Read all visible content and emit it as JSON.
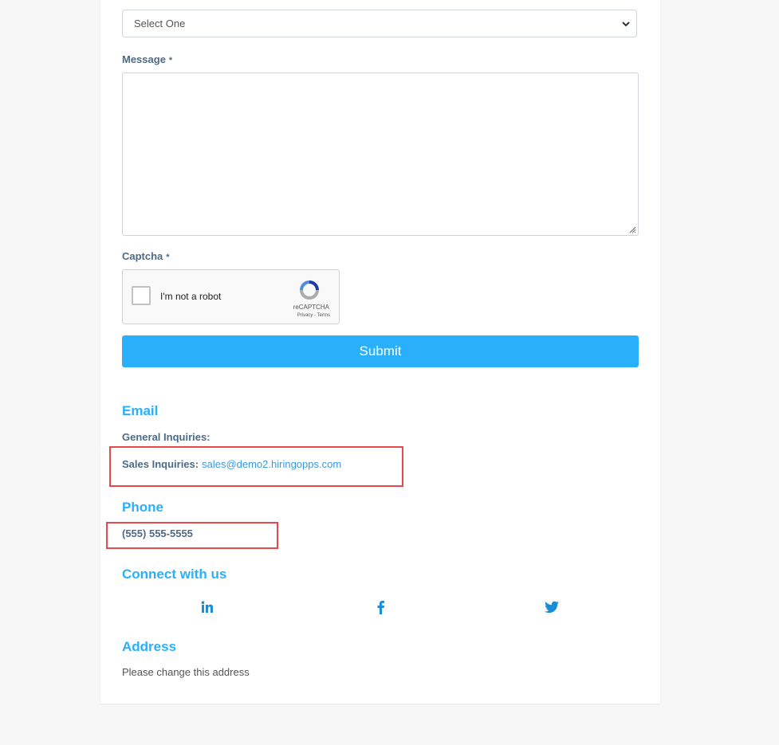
{
  "form": {
    "topic_select": {
      "value": "Select One"
    },
    "message": {
      "label": "Message",
      "required_mark": "*",
      "value": ""
    },
    "captcha": {
      "label": "Captcha",
      "required_mark": "*",
      "checkbox_label": "I'm not a robot",
      "brand": "reCAPTCHA",
      "links": "Privacy - Terms"
    },
    "submit_label": "Submit"
  },
  "contact": {
    "email": {
      "heading": "Email",
      "general_label": "General Inquiries:",
      "sales_label": "Sales Inquiries:",
      "sales_email": "sales@demo2.hiringopps.com"
    },
    "phone": {
      "heading": "Phone",
      "number": "(555) 555-5555"
    },
    "social": {
      "heading": "Connect with us",
      "links": [
        "linkedin",
        "facebook",
        "twitter"
      ]
    },
    "address": {
      "heading": "Address",
      "text": "Please change this address"
    }
  },
  "colors": {
    "accent": "#2ab0fb",
    "label": "#4e6a85",
    "highlight": "#e8474c"
  }
}
